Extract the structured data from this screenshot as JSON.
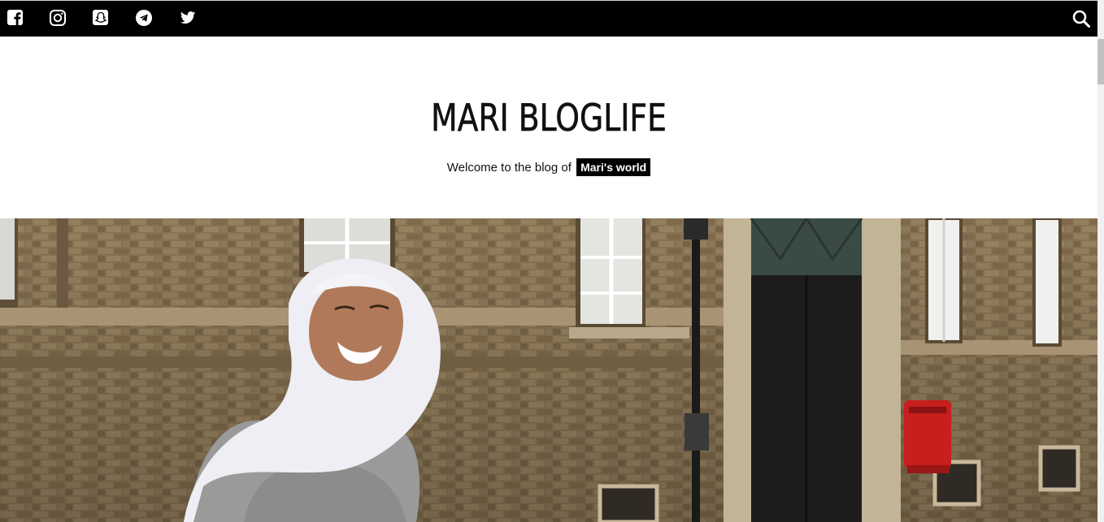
{
  "topbar": {
    "social_icons": [
      "facebook-icon",
      "instagram-icon",
      "snapchat-icon",
      "telegram-icon",
      "twitter-icon"
    ],
    "search_icon": "search-icon",
    "background": "#000000"
  },
  "header": {
    "title": "MARI BLOGLIFE",
    "tagline_prefix": "Welcome to the blog of",
    "tagline_highlight": "Mari's world"
  },
  "colors": {
    "accent": "#000000",
    "text": "#111111",
    "mailbox": "#c81e1e"
  }
}
